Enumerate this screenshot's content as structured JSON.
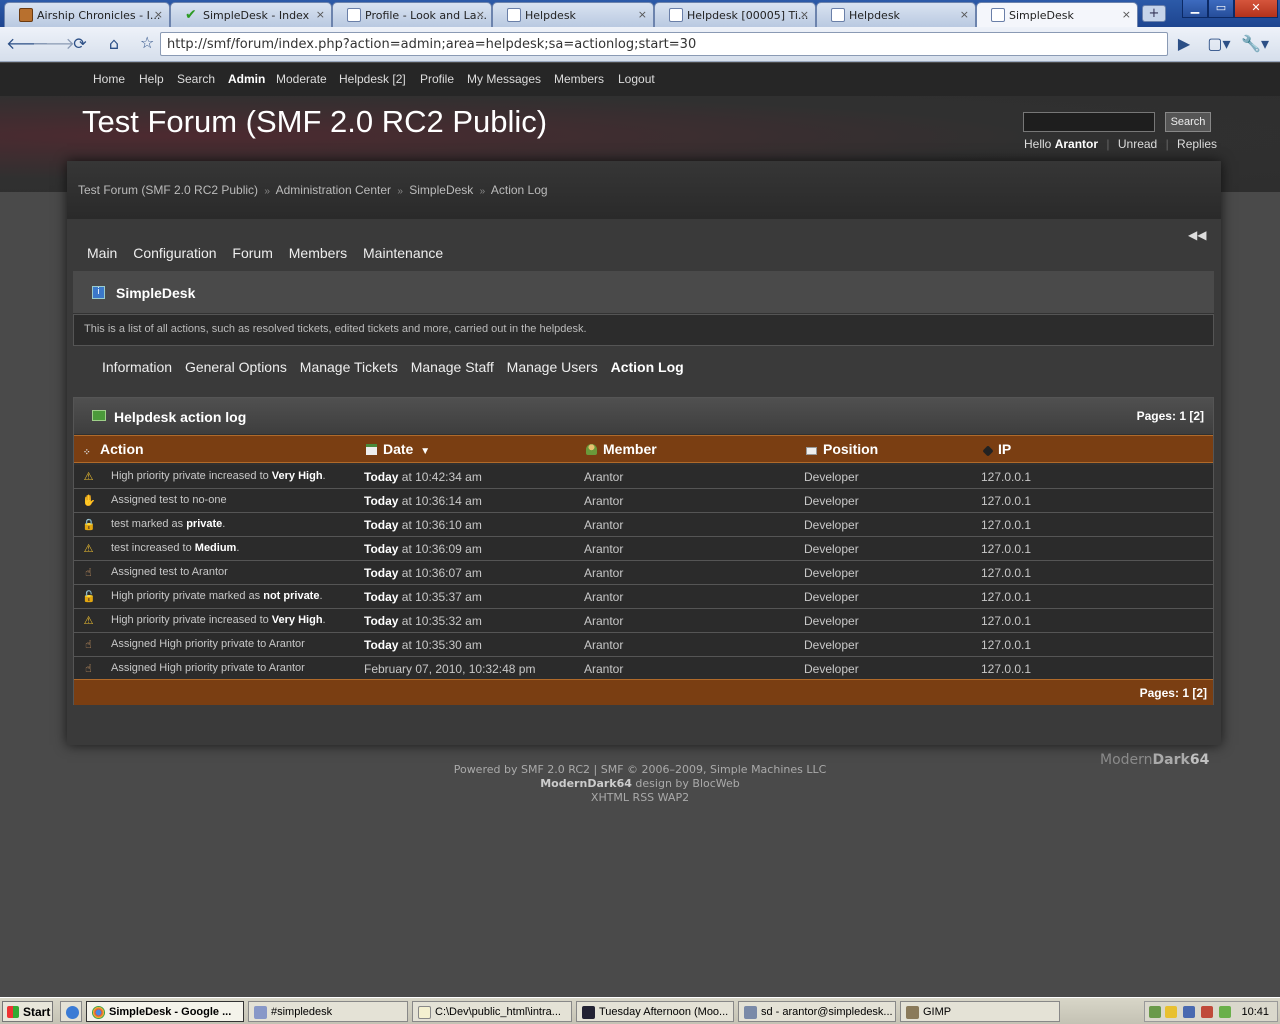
{
  "browser": {
    "tabs": [
      {
        "title": "Airship Chronicles - I...",
        "icon": "airship-favicon"
      },
      {
        "title": "SimpleDesk - Index",
        "icon": "checkmark-favicon"
      },
      {
        "title": "Profile - Look and La...",
        "icon": "page-favicon"
      },
      {
        "title": "Helpdesk",
        "icon": "page-favicon"
      },
      {
        "title": "Helpdesk [00005] Ti...",
        "icon": "page-favicon"
      },
      {
        "title": "Helpdesk",
        "icon": "page-favicon"
      },
      {
        "title": "SimpleDesk",
        "icon": "page-favicon"
      }
    ],
    "tab_close": "×",
    "new_tab": "+",
    "url": "http://smf/forum/index.php?action=admin;area=helpdesk;sa=actionlog;start=30"
  },
  "topnav": {
    "items": [
      "Home",
      "Help",
      "Search",
      "Admin",
      "Moderate",
      "Helpdesk [2]",
      "Profile",
      "My Messages",
      "Members",
      "Logout"
    ],
    "active": "Admin"
  },
  "header": {
    "forum_title": "Test Forum (SMF 2.0 RC2 Public)",
    "search_value": "",
    "search_button": "Search",
    "hello_text": "Hello",
    "username": "Arantor",
    "unread": "Unread",
    "replies": "Replies"
  },
  "breadcrumbs": [
    "Test Forum (SMF 2.0 RC2 Public)",
    "Administration Center",
    "SimpleDesk",
    "Action Log"
  ],
  "breadcrumb_separator": "»",
  "admin_menu": [
    "Main",
    "Configuration",
    "Forum",
    "Members",
    "Maintenance"
  ],
  "section": {
    "title": "SimpleDesk",
    "description": "This is a list of all actions, such as resolved tickets, edited tickets and more, carried out in the helpdesk."
  },
  "sub_menu": [
    "Information",
    "General Options",
    "Manage Tickets",
    "Manage Staff",
    "Manage Users",
    "Action Log"
  ],
  "sub_menu_active": "Action Log",
  "action_log": {
    "title": "Helpdesk action log",
    "pages_label": "Pages:",
    "pages": "1 [2]",
    "columns": {
      "action": "Action",
      "date": "Date",
      "member": "Member",
      "position": "Position",
      "ip": "IP"
    },
    "sort_indicator": "▼",
    "rows": [
      {
        "icon": "priority-up-icon",
        "glyph": "⚠",
        "action_pre": "High priority private increased to ",
        "action_bold": "Very High",
        "action_post": ".",
        "date_bold": "Today",
        "date_rest": " at 10:42:34 am",
        "member": "Arantor",
        "position": "Developer",
        "ip": "127.0.0.1"
      },
      {
        "icon": "assign-hand-icon",
        "glyph": "✋",
        "action_pre": "Assigned test to no-one",
        "action_bold": "",
        "action_post": "",
        "date_bold": "Today",
        "date_rest": " at 10:36:14 am",
        "member": "Arantor",
        "position": "Developer",
        "ip": "127.0.0.1"
      },
      {
        "icon": "lock-icon",
        "glyph": "🔒",
        "action_pre": "test marked as ",
        "action_bold": "private",
        "action_post": ".",
        "date_bold": "Today",
        "date_rest": " at 10:36:10 am",
        "member": "Arantor",
        "position": "Developer",
        "ip": "127.0.0.1"
      },
      {
        "icon": "priority-up-icon",
        "glyph": "⚠",
        "action_pre": "test increased to ",
        "action_bold": "Medium",
        "action_post": ".",
        "date_bold": "Today",
        "date_rest": " at 10:36:09 am",
        "member": "Arantor",
        "position": "Developer",
        "ip": "127.0.0.1"
      },
      {
        "icon": "assign-hand-icon",
        "glyph": "☝",
        "action_pre": "Assigned test to Arantor",
        "action_bold": "",
        "action_post": "",
        "date_bold": "Today",
        "date_rest": " at 10:36:07 am",
        "member": "Arantor",
        "position": "Developer",
        "ip": "127.0.0.1"
      },
      {
        "icon": "unlock-icon",
        "glyph": "🔓",
        "action_pre": "High priority private marked as ",
        "action_bold": "not private",
        "action_post": ".",
        "date_bold": "Today",
        "date_rest": " at 10:35:37 am",
        "member": "Arantor",
        "position": "Developer",
        "ip": "127.0.0.1"
      },
      {
        "icon": "priority-up-icon",
        "glyph": "⚠",
        "action_pre": "High priority private increased to ",
        "action_bold": "Very High",
        "action_post": ".",
        "date_bold": "Today",
        "date_rest": " at 10:35:32 am",
        "member": "Arantor",
        "position": "Developer",
        "ip": "127.0.0.1"
      },
      {
        "icon": "assign-hand-icon",
        "glyph": "☝",
        "action_pre": "Assigned High priority private to Arantor",
        "action_bold": "",
        "action_post": "",
        "date_bold": "Today",
        "date_rest": " at 10:35:30 am",
        "member": "Arantor",
        "position": "Developer",
        "ip": "127.0.0.1"
      },
      {
        "icon": "assign-hand-icon",
        "glyph": "☝",
        "action_pre": "Assigned High priority private to Arantor",
        "action_bold": "",
        "action_post": "",
        "date_bold": "",
        "date_rest": "February 07, 2010, 10:32:48 pm",
        "member": "Arantor",
        "position": "Developer",
        "ip": "127.0.0.1"
      }
    ]
  },
  "footer": {
    "powered": "Powered by SMF 2.0 RC2 | SMF © 2006–2009, Simple Machines LLC",
    "theme_name": "ModernDark64",
    "design_by": " design by BlocWeb",
    "links": "XHTML RSS WAP2",
    "logo_modern": "Modern",
    "logo_dark": "Dark",
    "logo_num": "64"
  },
  "taskbar": {
    "start": "Start",
    "tasks": [
      "SimpleDesk - Google ...",
      "#simpledesk",
      "C:\\Dev\\public_html\\intra...",
      "Tuesday Afternoon (Moo...",
      "sd - arantor@simpledesk...",
      "GIMP"
    ],
    "active_task": "SimpleDesk - Google ...",
    "clock": "10:41"
  },
  "colors": {
    "table_header": "#7a3e12",
    "page_bg": "#4a4a4a",
    "panel_bg": "#3a3a3a"
  }
}
